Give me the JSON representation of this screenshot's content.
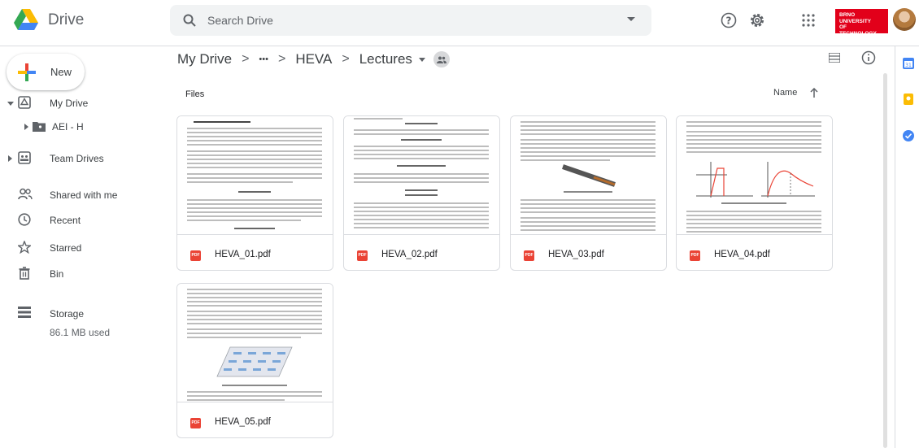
{
  "app": {
    "name": "Drive"
  },
  "search": {
    "placeholder": "Search Drive"
  },
  "university": {
    "lines": [
      "BRNO",
      "UNIVERSITY",
      "OF TECHNOLOGY"
    ]
  },
  "new_button": {
    "label": "New"
  },
  "sidebar": {
    "items": [
      {
        "label": "My Drive"
      },
      {
        "label": "AEI - H"
      },
      {
        "label": "Team Drives"
      },
      {
        "label": "Shared with me"
      },
      {
        "label": "Recent"
      },
      {
        "label": "Starred"
      },
      {
        "label": "Bin"
      },
      {
        "label": "Storage"
      }
    ],
    "storage_used": "86.1 MB used"
  },
  "breadcrumb": {
    "items": [
      "My Drive",
      "•••",
      "HEVA",
      "Lectures"
    ],
    "separator": ">"
  },
  "files_section": {
    "label": "Files",
    "sort_label": "Name"
  },
  "files": [
    {
      "name": "HEVA_01.pdf"
    },
    {
      "name": "HEVA_02.pdf"
    },
    {
      "name": "HEVA_03.pdf"
    },
    {
      "name": "HEVA_04.pdf"
    },
    {
      "name": "HEVA_05.pdf"
    }
  ],
  "colors": {
    "google_blue": "#4285f4",
    "google_red": "#ea4335",
    "google_yellow": "#fbbc04",
    "google_green": "#34a853",
    "uni_red": "#e2001a"
  }
}
